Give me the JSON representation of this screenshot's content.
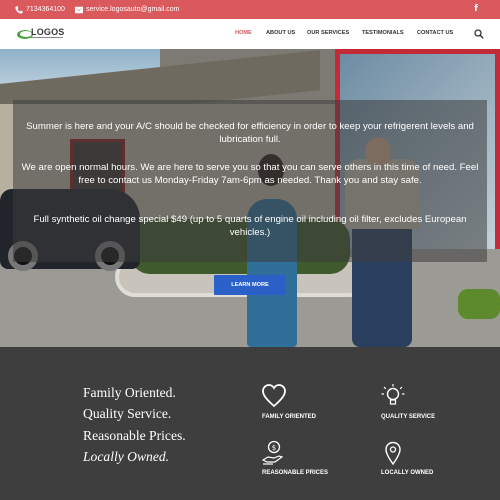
{
  "topbar": {
    "phone": "7134364100",
    "email": "service.logosauto@gmail.com",
    "social_icon": "facebook-icon",
    "social_glyph": "f"
  },
  "header": {
    "logo_text": "LOGOS",
    "nav": [
      "HOME",
      "ABOUT US",
      "OUR SERVICES",
      "TESTIMONIALS",
      "CONTACT US"
    ],
    "active_index": 0,
    "search_icon": "search-icon"
  },
  "hero": {
    "paragraphs": [
      "Summer is here and your A/C should be checked for efficiency in order to keep your refrigerent levels and lubrication full.",
      "We are open normal hours. We are here to serve you so that you can serve others in this time of need. Feel free to contact us Monday-Friday 7am-6pm as needed. Thank you and stay safe.",
      "Full synthetic oil change special $49 (up to 5 quarts of engine oil including oil filter, excludes European vehicles.)"
    ],
    "button_label": "LEARN MORE"
  },
  "features": {
    "motto": [
      "Family Oriented.",
      "Quality Service.",
      "Reasonable Prices.",
      "Locally Owned."
    ],
    "items": [
      {
        "label": "FAMILY ORIENTED",
        "icon": "heart-icon"
      },
      {
        "label": "QUALITY SERVICE",
        "icon": "lightbulb-icon"
      },
      {
        "label": "REASONABLE PRICES",
        "icon": "money-hand-icon"
      },
      {
        "label": "LOCALLY OWNED",
        "icon": "location-pin-icon"
      }
    ]
  },
  "colors": {
    "topbar": "#d9595d",
    "accent": "#d9595d",
    "button": "#2b60c9",
    "features_bg": "#3e3e3e"
  }
}
